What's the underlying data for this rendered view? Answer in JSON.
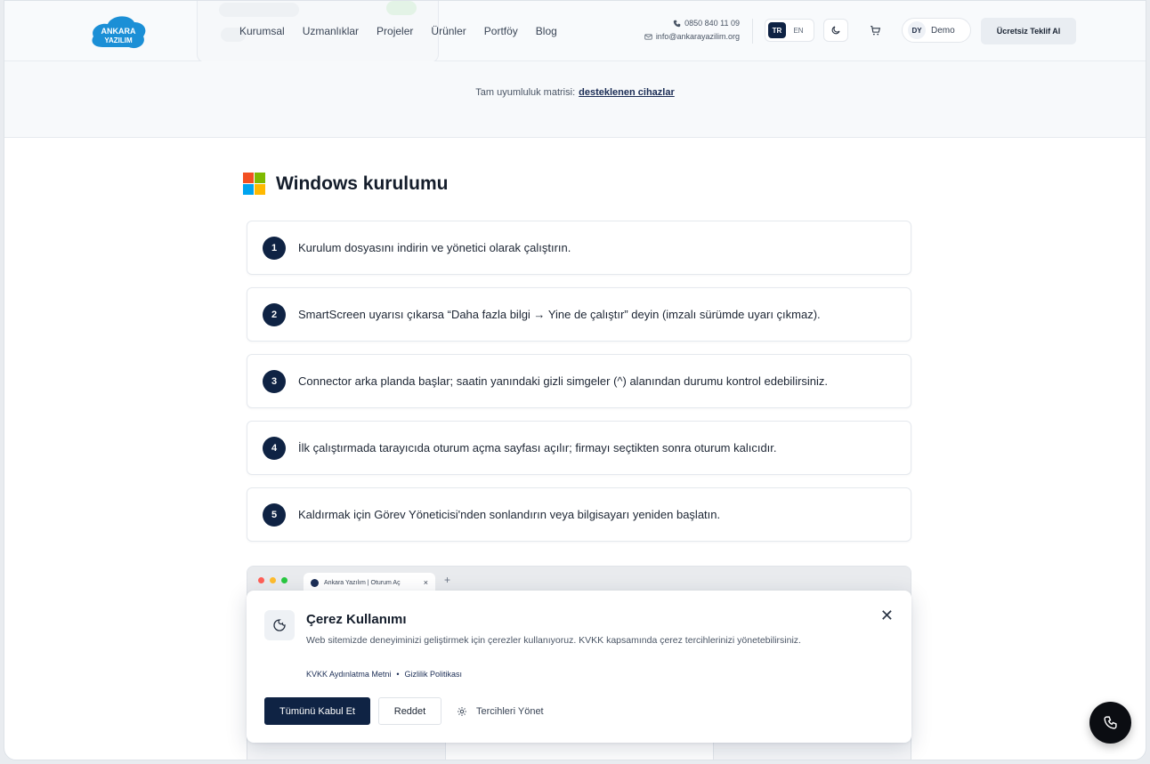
{
  "brand": {
    "line1": "ANKARA",
    "line2": "YAZILIM",
    "color": "#1b8fd6"
  },
  "nav": {
    "items": [
      "Kurumsal",
      "Uzmanlıklar",
      "Projeler",
      "Ürünler",
      "Portföy",
      "Blog"
    ]
  },
  "contact": {
    "phone": "0850 840 11 09",
    "email": "info@ankarayazilim.org"
  },
  "lang": {
    "active": "TR",
    "other": "EN"
  },
  "user": {
    "initials": "DY",
    "name": "Demo"
  },
  "cta_label": "Ücretsiz Teklif Al",
  "notice": {
    "text": "Tam uyumluluk matrisi:",
    "link": "desteklenen cihazlar"
  },
  "section": {
    "title": "Windows kurulumu"
  },
  "steps": [
    {
      "num": "1",
      "text": "Kurulum dosyasını indirin ve yönetici olarak çalıştırın."
    },
    {
      "num": "2",
      "text": "SmartScreen uyarısı çıkarsa “Daha fazla bilgi → Yine de çalıştır” deyin (imzalı sürümde uyarı çıkmaz)."
    },
    {
      "num": "3",
      "text": "Connector arka planda başlar; saatin yanındaki gizli simgeler (^) alanından durumu kontrol edebilirsiniz."
    },
    {
      "num": "4",
      "text": "İlk çalıştırmada tarayıcıda oturum açma sayfası açılır; firmayı seçtikten sonra oturum kalıcıdır."
    },
    {
      "num": "5",
      "text": "Kaldırmak için Görev Yöneticisi'nden sonlandırın veya bilgisayarı yeniden başlatın."
    }
  ],
  "browser": {
    "tab_title": "Ankara Yazılım | Oturum Aç"
  },
  "cookie": {
    "title": "Çerez Kullanımı",
    "desc": "Web sitemizde deneyiminizi geliştirmek için çerezler kullanıyoruz. KVKK kapsamında çerez tercihlerinizi yönetebilirsiniz.",
    "link1": "KVKK Aydınlatma Metni",
    "sep": "•",
    "link2": "Gizlilik Politikası",
    "accept": "Tümünü Kabul Et",
    "reject": "Reddet",
    "manage": "Tercihleri Yönet"
  },
  "colors": {
    "navy": "#0f2344",
    "win_red": "#f25022",
    "win_green": "#7fba00",
    "win_blue": "#00a4ef",
    "win_yellow": "#ffb900"
  }
}
